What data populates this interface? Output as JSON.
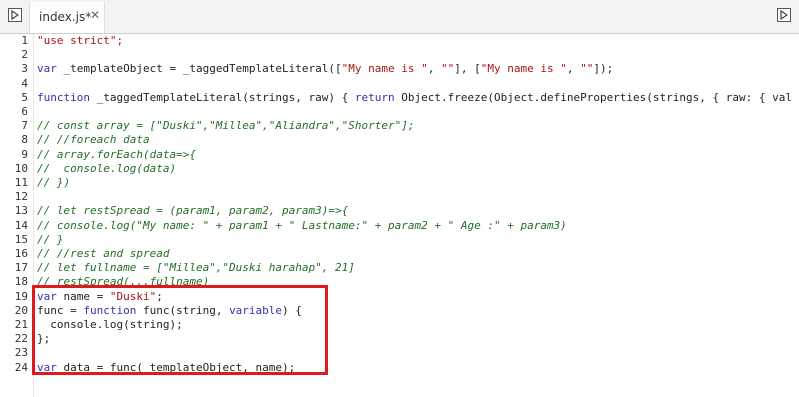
{
  "tab": {
    "filename": "index.js*",
    "close": "✕"
  },
  "icons": {
    "left_panel": "play-panel-icon",
    "right_panel": "play-panel-icon"
  },
  "accent_color": "#1e88e5",
  "highlight_color": "#e0191f",
  "lines": [
    {
      "n": "1",
      "parts": [
        {
          "t": "\"use strict\";",
          "c": "str"
        }
      ]
    },
    {
      "n": "2",
      "parts": []
    },
    {
      "n": "3",
      "parts": [
        {
          "t": "var",
          "c": "kw"
        },
        {
          "t": " _templateObject = _taggedTemplateLiteral([",
          "c": ""
        },
        {
          "t": "\"My name is \"",
          "c": "str"
        },
        {
          "t": ", ",
          "c": ""
        },
        {
          "t": "\"\"",
          "c": "str"
        },
        {
          "t": "], [",
          "c": ""
        },
        {
          "t": "\"My name is \"",
          "c": "str"
        },
        {
          "t": ", ",
          "c": ""
        },
        {
          "t": "\"\"",
          "c": "str"
        },
        {
          "t": "]);",
          "c": ""
        }
      ]
    },
    {
      "n": "4",
      "parts": []
    },
    {
      "n": "5",
      "parts": [
        {
          "t": "function",
          "c": "kw"
        },
        {
          "t": " _taggedTemplateLiteral(strings, raw) { ",
          "c": ""
        },
        {
          "t": "return",
          "c": "kw"
        },
        {
          "t": " Object.freeze(Object.defineProperties(strings, { raw: { val",
          "c": ""
        }
      ]
    },
    {
      "n": "6",
      "parts": []
    },
    {
      "n": "7",
      "parts": [
        {
          "t": "// const array = [\"Duski\",\"Millea\",\"Aliandra\",\"Shorter\"];",
          "c": "cm"
        }
      ]
    },
    {
      "n": "8",
      "parts": [
        {
          "t": "// //foreach data",
          "c": "cm"
        }
      ]
    },
    {
      "n": "9",
      "parts": [
        {
          "t": "// array.forEach(data=>{",
          "c": "cm"
        }
      ]
    },
    {
      "n": "10",
      "parts": [
        {
          "t": "//  console.log(data)",
          "c": "cm"
        }
      ]
    },
    {
      "n": "11",
      "parts": [
        {
          "t": "// })",
          "c": "cm"
        }
      ]
    },
    {
      "n": "12",
      "parts": []
    },
    {
      "n": "13",
      "parts": [
        {
          "t": "// let restSpread = (param1, param2, param3)=>{",
          "c": "cm"
        }
      ]
    },
    {
      "n": "14",
      "parts": [
        {
          "t": "// console.log(\"My name: \" + param1 + \" Lastname:\" + param2 + \" Age :\" + param3)",
          "c": "cm"
        }
      ]
    },
    {
      "n": "15",
      "parts": [
        {
          "t": "// }",
          "c": "cm"
        }
      ]
    },
    {
      "n": "16",
      "parts": [
        {
          "t": "// //rest and spread",
          "c": "cm"
        }
      ]
    },
    {
      "n": "17",
      "parts": [
        {
          "t": "// let fullname = [\"Millea\",\"Duski harahap\", 21]",
          "c": "cm"
        }
      ]
    },
    {
      "n": "18",
      "parts": [
        {
          "t": "// restSpread(...fullname)",
          "c": "cm"
        }
      ]
    },
    {
      "n": "19",
      "parts": [
        {
          "t": "var",
          "c": "kw"
        },
        {
          "t": " name = ",
          "c": ""
        },
        {
          "t": "\"Duski\"",
          "c": "str"
        },
        {
          "t": ";",
          "c": ""
        }
      ]
    },
    {
      "n": "20",
      "parts": [
        {
          "t": "func = ",
          "c": ""
        },
        {
          "t": "function",
          "c": "kw"
        },
        {
          "t": " func(string, ",
          "c": ""
        },
        {
          "t": "variable",
          "c": "kw"
        },
        {
          "t": ") {",
          "c": ""
        }
      ]
    },
    {
      "n": "21",
      "parts": [
        {
          "t": "  console.log(string);",
          "c": ""
        }
      ]
    },
    {
      "n": "22",
      "parts": [
        {
          "t": "};",
          "c": ""
        }
      ]
    },
    {
      "n": "23",
      "parts": []
    },
    {
      "n": "24",
      "parts": [
        {
          "t": "var",
          "c": "kw"
        },
        {
          "t": " data = func(_templateObject, name);",
          "c": ""
        }
      ]
    }
  ]
}
